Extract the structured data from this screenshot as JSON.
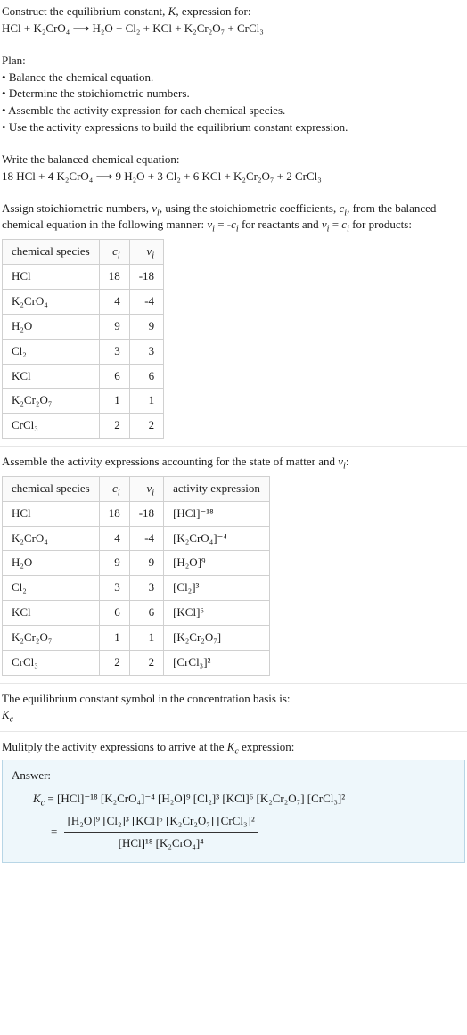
{
  "intro": {
    "line1": "Construct the equilibrium constant, K, expression for:",
    "equation": "HCl + K₂CrO₄ ⟶ H₂O + Cl₂ + KCl + K₂Cr₂O₇ + CrCl₃"
  },
  "plan": {
    "heading": "Plan:",
    "items": [
      "Balance the chemical equation.",
      "Determine the stoichiometric numbers.",
      "Assemble the activity expression for each chemical species.",
      "Use the activity expressions to build the equilibrium constant expression."
    ]
  },
  "balanced": {
    "heading": "Write the balanced chemical equation:",
    "equation": "18 HCl + 4 K₂CrO₄ ⟶ 9 H₂O + 3 Cl₂ + 6 KCl + K₂Cr₂O₇ + 2 CrCl₃"
  },
  "stoich": {
    "intro1": "Assign stoichiometric numbers, νᵢ, using the stoichiometric coefficients, cᵢ, from the balanced chemical equation in the following manner: νᵢ = -cᵢ for reactants and νᵢ = cᵢ for products:",
    "headers": {
      "species": "chemical species",
      "ci": "cᵢ",
      "vi": "νᵢ"
    },
    "rows": [
      {
        "species": "HCl",
        "ci": "18",
        "vi": "-18"
      },
      {
        "species": "K₂CrO₄",
        "ci": "4",
        "vi": "-4"
      },
      {
        "species": "H₂O",
        "ci": "9",
        "vi": "9"
      },
      {
        "species": "Cl₂",
        "ci": "3",
        "vi": "3"
      },
      {
        "species": "KCl",
        "ci": "6",
        "vi": "6"
      },
      {
        "species": "K₂Cr₂O₇",
        "ci": "1",
        "vi": "1"
      },
      {
        "species": "CrCl₃",
        "ci": "2",
        "vi": "2"
      }
    ]
  },
  "activity": {
    "intro": "Assemble the activity expressions accounting for the state of matter and νᵢ:",
    "headers": {
      "species": "chemical species",
      "ci": "cᵢ",
      "vi": "νᵢ",
      "act": "activity expression"
    },
    "rows": [
      {
        "species": "HCl",
        "ci": "18",
        "vi": "-18",
        "act": "[HCl]⁻¹⁸"
      },
      {
        "species": "K₂CrO₄",
        "ci": "4",
        "vi": "-4",
        "act": "[K₂CrO₄]⁻⁴"
      },
      {
        "species": "H₂O",
        "ci": "9",
        "vi": "9",
        "act": "[H₂O]⁹"
      },
      {
        "species": "Cl₂",
        "ci": "3",
        "vi": "3",
        "act": "[Cl₂]³"
      },
      {
        "species": "KCl",
        "ci": "6",
        "vi": "6",
        "act": "[KCl]⁶"
      },
      {
        "species": "K₂Cr₂O₇",
        "ci": "1",
        "vi": "1",
        "act": "[K₂Cr₂O₇]"
      },
      {
        "species": "CrCl₃",
        "ci": "2",
        "vi": "2",
        "act": "[CrCl₃]²"
      }
    ]
  },
  "symbol": {
    "line1": "The equilibrium constant symbol in the concentration basis is:",
    "line2": "K_c"
  },
  "final": {
    "intro": "Mulitply the activity expressions to arrive at the K_c expression:",
    "answer_label": "Answer:",
    "expr_line1": "K_c = [HCl]⁻¹⁸ [K₂CrO₄]⁻⁴ [H₂O]⁹ [Cl₂]³ [KCl]⁶ [K₂Cr₂O₇] [CrCl₃]²",
    "frac_num": "[H₂O]⁹ [Cl₂]³ [KCl]⁶ [K₂Cr₂O₇] [CrCl₃]²",
    "frac_den": "[HCl]¹⁸ [K₂CrO₄]⁴"
  }
}
